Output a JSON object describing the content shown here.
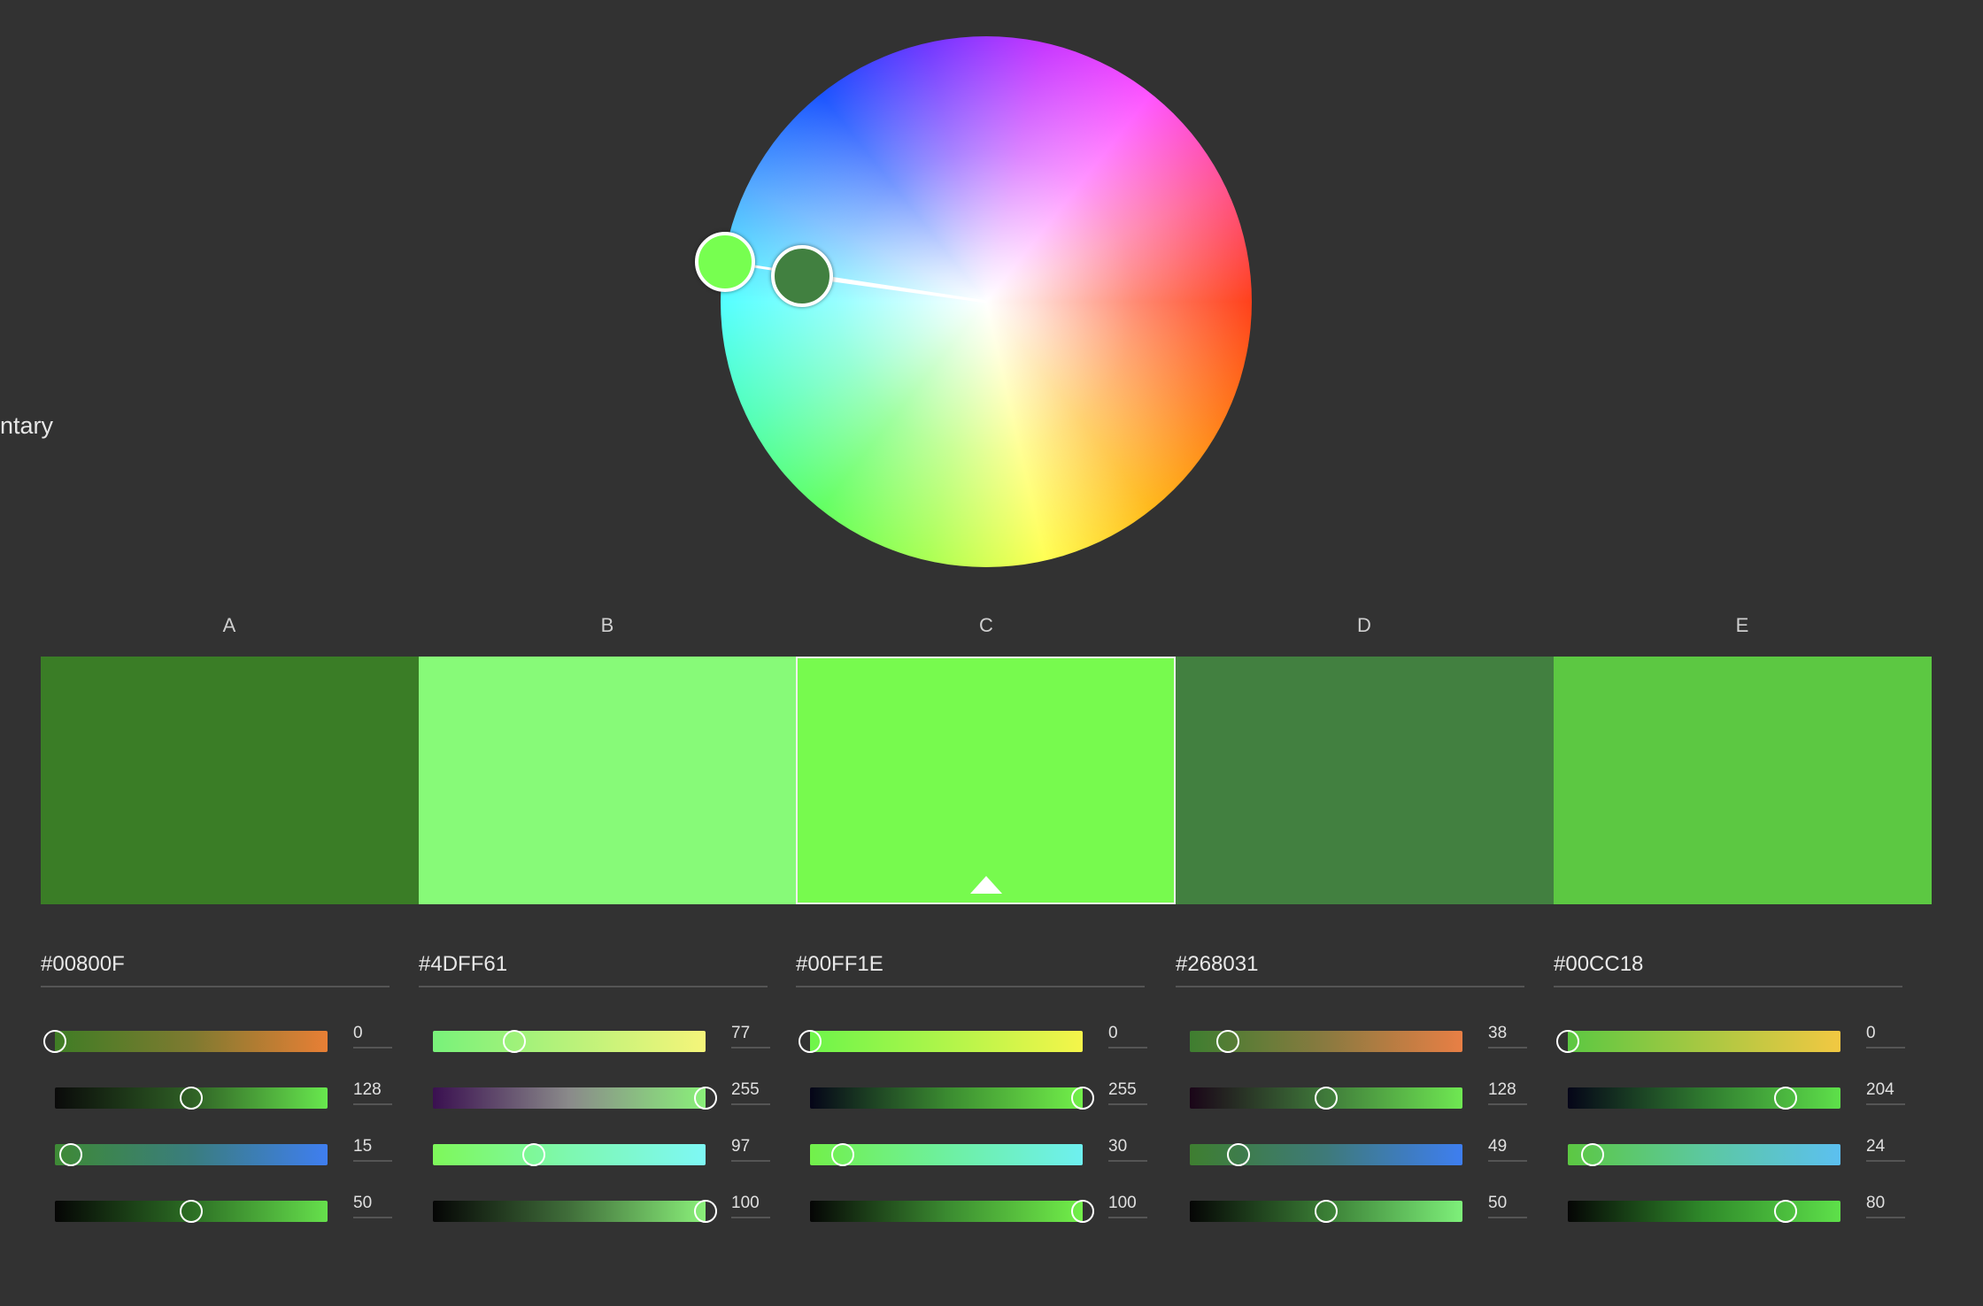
{
  "rule_label": "ntary",
  "swatches": [
    {
      "label": "A",
      "hex": "#00800F",
      "fill": "#3a7d26",
      "channels": [
        {
          "value": "0",
          "fraction": 0.0,
          "gradient": [
            "#3f7d25",
            "#7e7a30",
            "#e87f35"
          ]
        },
        {
          "value": "128",
          "fraction": 0.5,
          "gradient": [
            "#0a0a0a",
            "#2f6025",
            "#68e84e"
          ]
        },
        {
          "value": "15",
          "fraction": 0.06,
          "gradient": [
            "#3e8a35",
            "#3a7d7e",
            "#3f7ef0"
          ]
        },
        {
          "value": "50",
          "fraction": 0.5,
          "gradient": [
            "#050505",
            "#2c6e24",
            "#66e04c"
          ]
        }
      ]
    },
    {
      "label": "B",
      "hex": "#4DFF61",
      "fill": "#87fa78",
      "channels": [
        {
          "value": "77",
          "fraction": 0.3,
          "gradient": [
            "#78f27a",
            "#b8f27a",
            "#f5f57a"
          ]
        },
        {
          "value": "255",
          "fraction": 1.0,
          "gradient": [
            "#3a1050",
            "#8a8a8a",
            "#8af07a"
          ]
        },
        {
          "value": "97",
          "fraction": 0.37,
          "gradient": [
            "#7ef85a",
            "#7ef8b0",
            "#7ef8f5"
          ]
        },
        {
          "value": "100",
          "fraction": 1.0,
          "gradient": [
            "#050505",
            "#406e3a",
            "#8af07a"
          ]
        }
      ]
    },
    {
      "label": "C",
      "hex": "#00FF1E",
      "fill": "#77fa4e",
      "channels": [
        {
          "value": "0",
          "fraction": 0.0,
          "gradient": [
            "#6ef54a",
            "#b0f54a",
            "#f5f54a"
          ]
        },
        {
          "value": "255",
          "fraction": 1.0,
          "gradient": [
            "#050518",
            "#3a8a30",
            "#72f04a"
          ]
        },
        {
          "value": "30",
          "fraction": 0.12,
          "gradient": [
            "#72f04a",
            "#6ef0a0",
            "#6ef0f0"
          ]
        },
        {
          "value": "100",
          "fraction": 1.0,
          "gradient": [
            "#050505",
            "#3a8a30",
            "#72f04a"
          ]
        }
      ]
    },
    {
      "label": "D",
      "hex": "#268031",
      "fill": "#428040",
      "channels": [
        {
          "value": "38",
          "fraction": 0.14,
          "gradient": [
            "#3e7e30",
            "#8a7a40",
            "#e87f45"
          ]
        },
        {
          "value": "128",
          "fraction": 0.5,
          "gradient": [
            "#1a0518",
            "#3f7a3a",
            "#6fe852"
          ]
        },
        {
          "value": "49",
          "fraction": 0.18,
          "gradient": [
            "#3e7e30",
            "#3e7a7a",
            "#3e7ef0"
          ]
        },
        {
          "value": "50",
          "fraction": 0.5,
          "gradient": [
            "#050505",
            "#3a7e35",
            "#7ef07a"
          ]
        }
      ]
    },
    {
      "label": "E",
      "hex": "#00CC18",
      "fill": "#5cc842",
      "channels": [
        {
          "value": "0",
          "fraction": 0.0,
          "gradient": [
            "#5cc842",
            "#a8c842",
            "#f2c842"
          ]
        },
        {
          "value": "204",
          "fraction": 0.8,
          "gradient": [
            "#050518",
            "#2f7a2f",
            "#5ee04a"
          ]
        },
        {
          "value": "24",
          "fraction": 0.09,
          "gradient": [
            "#5cc842",
            "#5cc8a0",
            "#5cc0f0"
          ]
        },
        {
          "value": "80",
          "fraction": 0.8,
          "gradient": [
            "#050505",
            "#2f8a2a",
            "#5ee04a"
          ]
        }
      ]
    }
  ]
}
